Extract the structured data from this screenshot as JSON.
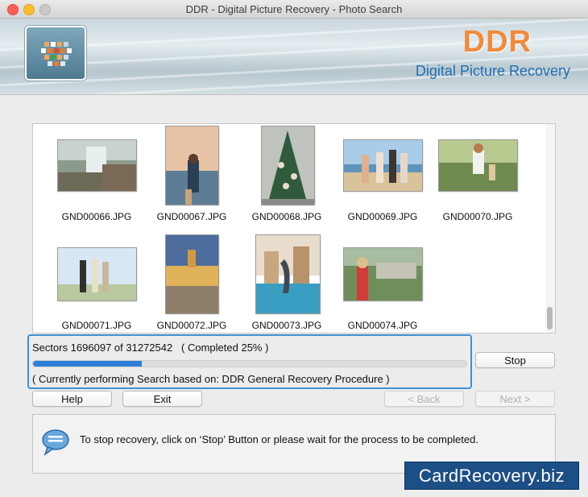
{
  "window": {
    "title": "DDR - Digital Picture Recovery - Photo Search"
  },
  "banner": {
    "brand": "DDR",
    "subtitle": "Digital Picture Recovery",
    "logo_icon": "ddr-logo-icon"
  },
  "gallery": {
    "items": [
      {
        "filename": "GND00066.JPG",
        "subject": "waterfall"
      },
      {
        "filename": "GND00067.JPG",
        "subject": "woman-sea"
      },
      {
        "filename": "GND00068.JPG",
        "subject": "christmas-tree"
      },
      {
        "filename": "GND00069.JPG",
        "subject": "beach-friends"
      },
      {
        "filename": "GND00070.JPG",
        "subject": "kids-garden"
      },
      {
        "filename": "GND00071.JPG",
        "subject": "hikers"
      },
      {
        "filename": "GND00072.JPG",
        "subject": "palace"
      },
      {
        "filename": "GND00073.JPG",
        "subject": "dolphin"
      },
      {
        "filename": "GND00074.JPG",
        "subject": "woman-city"
      }
    ]
  },
  "progress": {
    "sectors_text": "Sectors 1696097 of 31272542",
    "completed_text": "( Completed 25% )",
    "percent": 25,
    "procedure_text": "( Currently performing Search based on: DDR General Recovery Procedure )"
  },
  "buttons": {
    "stop": "Stop",
    "help": "Help",
    "exit": "Exit",
    "back": "< Back",
    "next": "Next >"
  },
  "info": {
    "icon": "speech-bubble-icon",
    "message": "To stop recovery, click on ‘Stop’ Button or please wait for the process to be completed."
  },
  "watermark": {
    "text": "CardRecovery.biz"
  },
  "colors": {
    "accent": "#3d8fd6",
    "progress": "#2f7ed8",
    "brand": "#f08a3c",
    "subtitle": "#1e6fb4"
  }
}
